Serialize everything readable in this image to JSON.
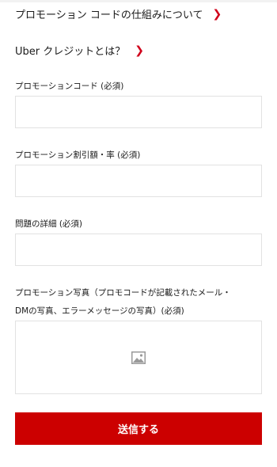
{
  "links": {
    "promo_howto": "プロモーション コードの仕組みについて",
    "uber_credit": "Uber クレジットとは？",
    "chevron": "›"
  },
  "form": {
    "promo_code_label": "プロモーションコード (必須)",
    "promo_code_value": "",
    "discount_label": "プロモーション割引額・率 (必須)",
    "discount_value": "",
    "issue_label": "問題の詳細 (必須)",
    "issue_value": "",
    "photo_label_line1": "プロモーション写真（プロモコードが記載されたメール・",
    "photo_label_line2": "DMの写真、エラーメッセージの写真）(必須)",
    "photo_icon": "image-icon",
    "submit_label": "送信する"
  },
  "colors": {
    "accent": "#cc0000",
    "chevron": "#d0021b",
    "border": "#e2e2e2"
  }
}
